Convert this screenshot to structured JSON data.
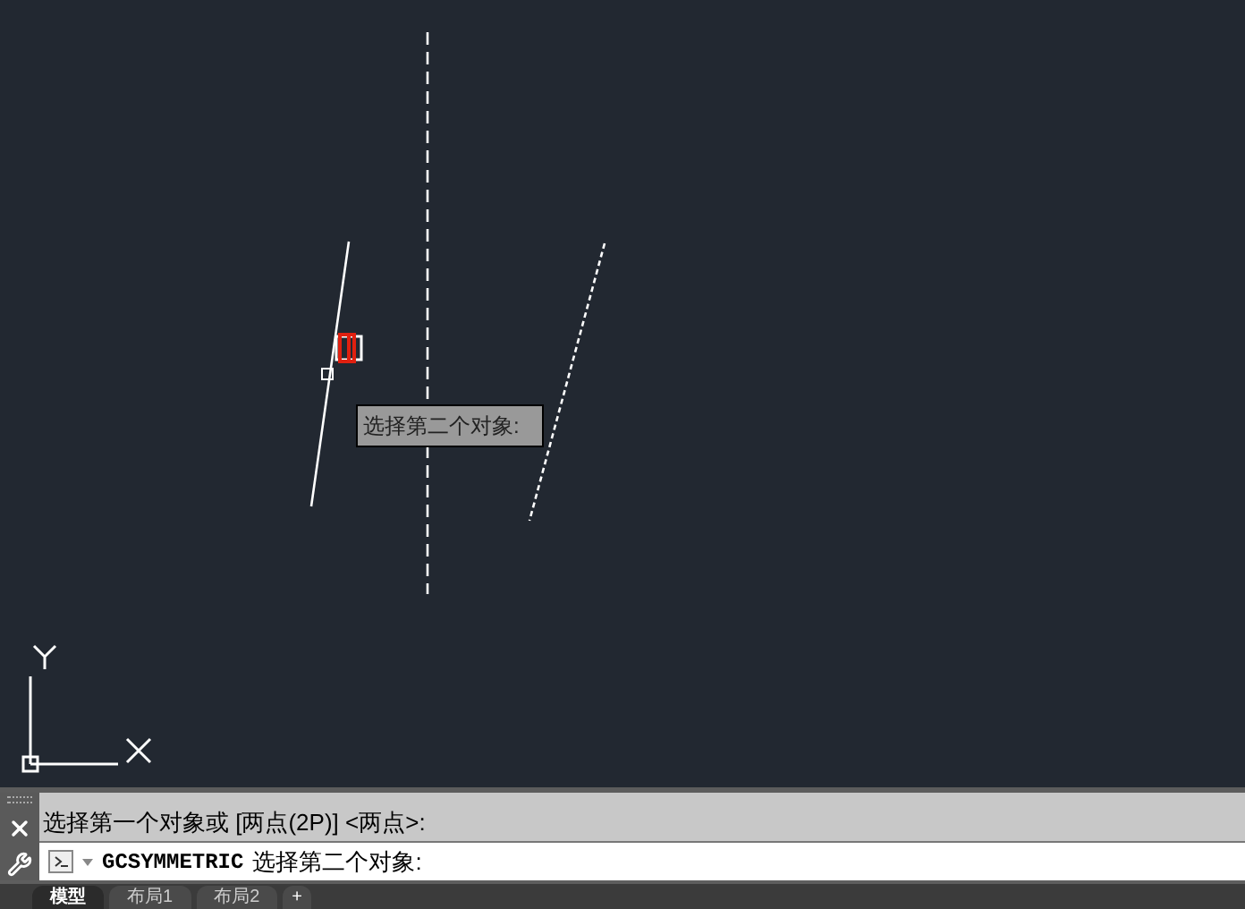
{
  "canvas": {
    "tooltip": "选择第二个对象:"
  },
  "command_history": [
    "选择第一个对象或 [两点(2P)] <两点>:"
  ],
  "command_line": {
    "command": "GCSYMMETRIC",
    "prompt": "选择第二个对象:"
  },
  "layout_tabs": [
    {
      "label": "模型",
      "selected": true
    },
    {
      "label": "布局1",
      "selected": false
    },
    {
      "label": "布局2",
      "selected": false
    }
  ],
  "add_tab": "+"
}
